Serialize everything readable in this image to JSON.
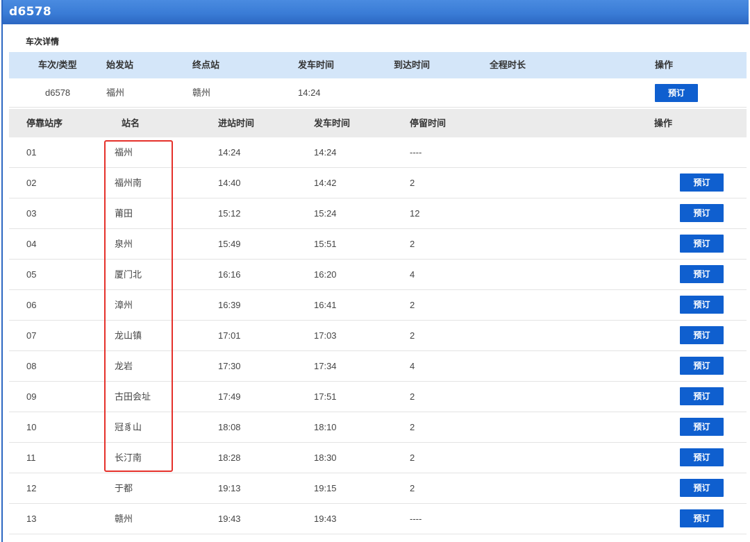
{
  "header": {
    "title": "d6578"
  },
  "train_detail": {
    "section_label": "车次详情",
    "columns": {
      "train_type": "车次/类型",
      "origin": "始发站",
      "terminus": "终点站",
      "depart_time": "发车时间",
      "arrive_time": "到达时间",
      "duration": "全程时长",
      "action": "操作"
    },
    "row": {
      "train_no": "d6578",
      "origin": "福州",
      "terminus": "赣州",
      "depart_time": "14:24",
      "book_label": "预订"
    }
  },
  "stops": {
    "columns": {
      "seq": "停靠站序",
      "name": "站名",
      "arrive": "进站时间",
      "depart": "发车时间",
      "stay": "停留时间",
      "action": "操作"
    },
    "book_label": "预订",
    "rows": [
      {
        "seq": "01",
        "name": "福州",
        "arrive": "14:24",
        "depart": "14:24",
        "stay": "----",
        "bookable": false
      },
      {
        "seq": "02",
        "name": "福州南",
        "arrive": "14:40",
        "depart": "14:42",
        "stay": "2",
        "bookable": true
      },
      {
        "seq": "03",
        "name": "莆田",
        "arrive": "15:12",
        "depart": "15:24",
        "stay": "12",
        "bookable": true
      },
      {
        "seq": "04",
        "name": "泉州",
        "arrive": "15:49",
        "depart": "15:51",
        "stay": "2",
        "bookable": true
      },
      {
        "seq": "05",
        "name": "厦门北",
        "arrive": "16:16",
        "depart": "16:20",
        "stay": "4",
        "bookable": true
      },
      {
        "seq": "06",
        "name": "漳州",
        "arrive": "16:39",
        "depart": "16:41",
        "stay": "2",
        "bookable": true
      },
      {
        "seq": "07",
        "name": "龙山镇",
        "arrive": "17:01",
        "depart": "17:03",
        "stay": "2",
        "bookable": true
      },
      {
        "seq": "08",
        "name": "龙岩",
        "arrive": "17:30",
        "depart": "17:34",
        "stay": "4",
        "bookable": true
      },
      {
        "seq": "09",
        "name": "古田会址",
        "arrive": "17:49",
        "depart": "17:51",
        "stay": "2",
        "bookable": true
      },
      {
        "seq": "10",
        "name": "冠豸山",
        "arrive": "18:08",
        "depart": "18:10",
        "stay": "2",
        "bookable": true
      },
      {
        "seq": "11",
        "name": "长汀南",
        "arrive": "18:28",
        "depart": "18:30",
        "stay": "2",
        "bookable": true
      },
      {
        "seq": "12",
        "name": "于都",
        "arrive": "19:13",
        "depart": "19:15",
        "stay": "2",
        "bookable": true
      },
      {
        "seq": "13",
        "name": "赣州",
        "arrive": "19:43",
        "depart": "19:43",
        "stay": "----",
        "bookable": true
      }
    ]
  },
  "colors": {
    "header_blue": "#3a7cd6",
    "button_blue": "#0f5fcf",
    "highlight_red": "#e5302a",
    "detail_header_bg": "#d4e6f9",
    "stops_header_bg": "#ebebeb"
  }
}
